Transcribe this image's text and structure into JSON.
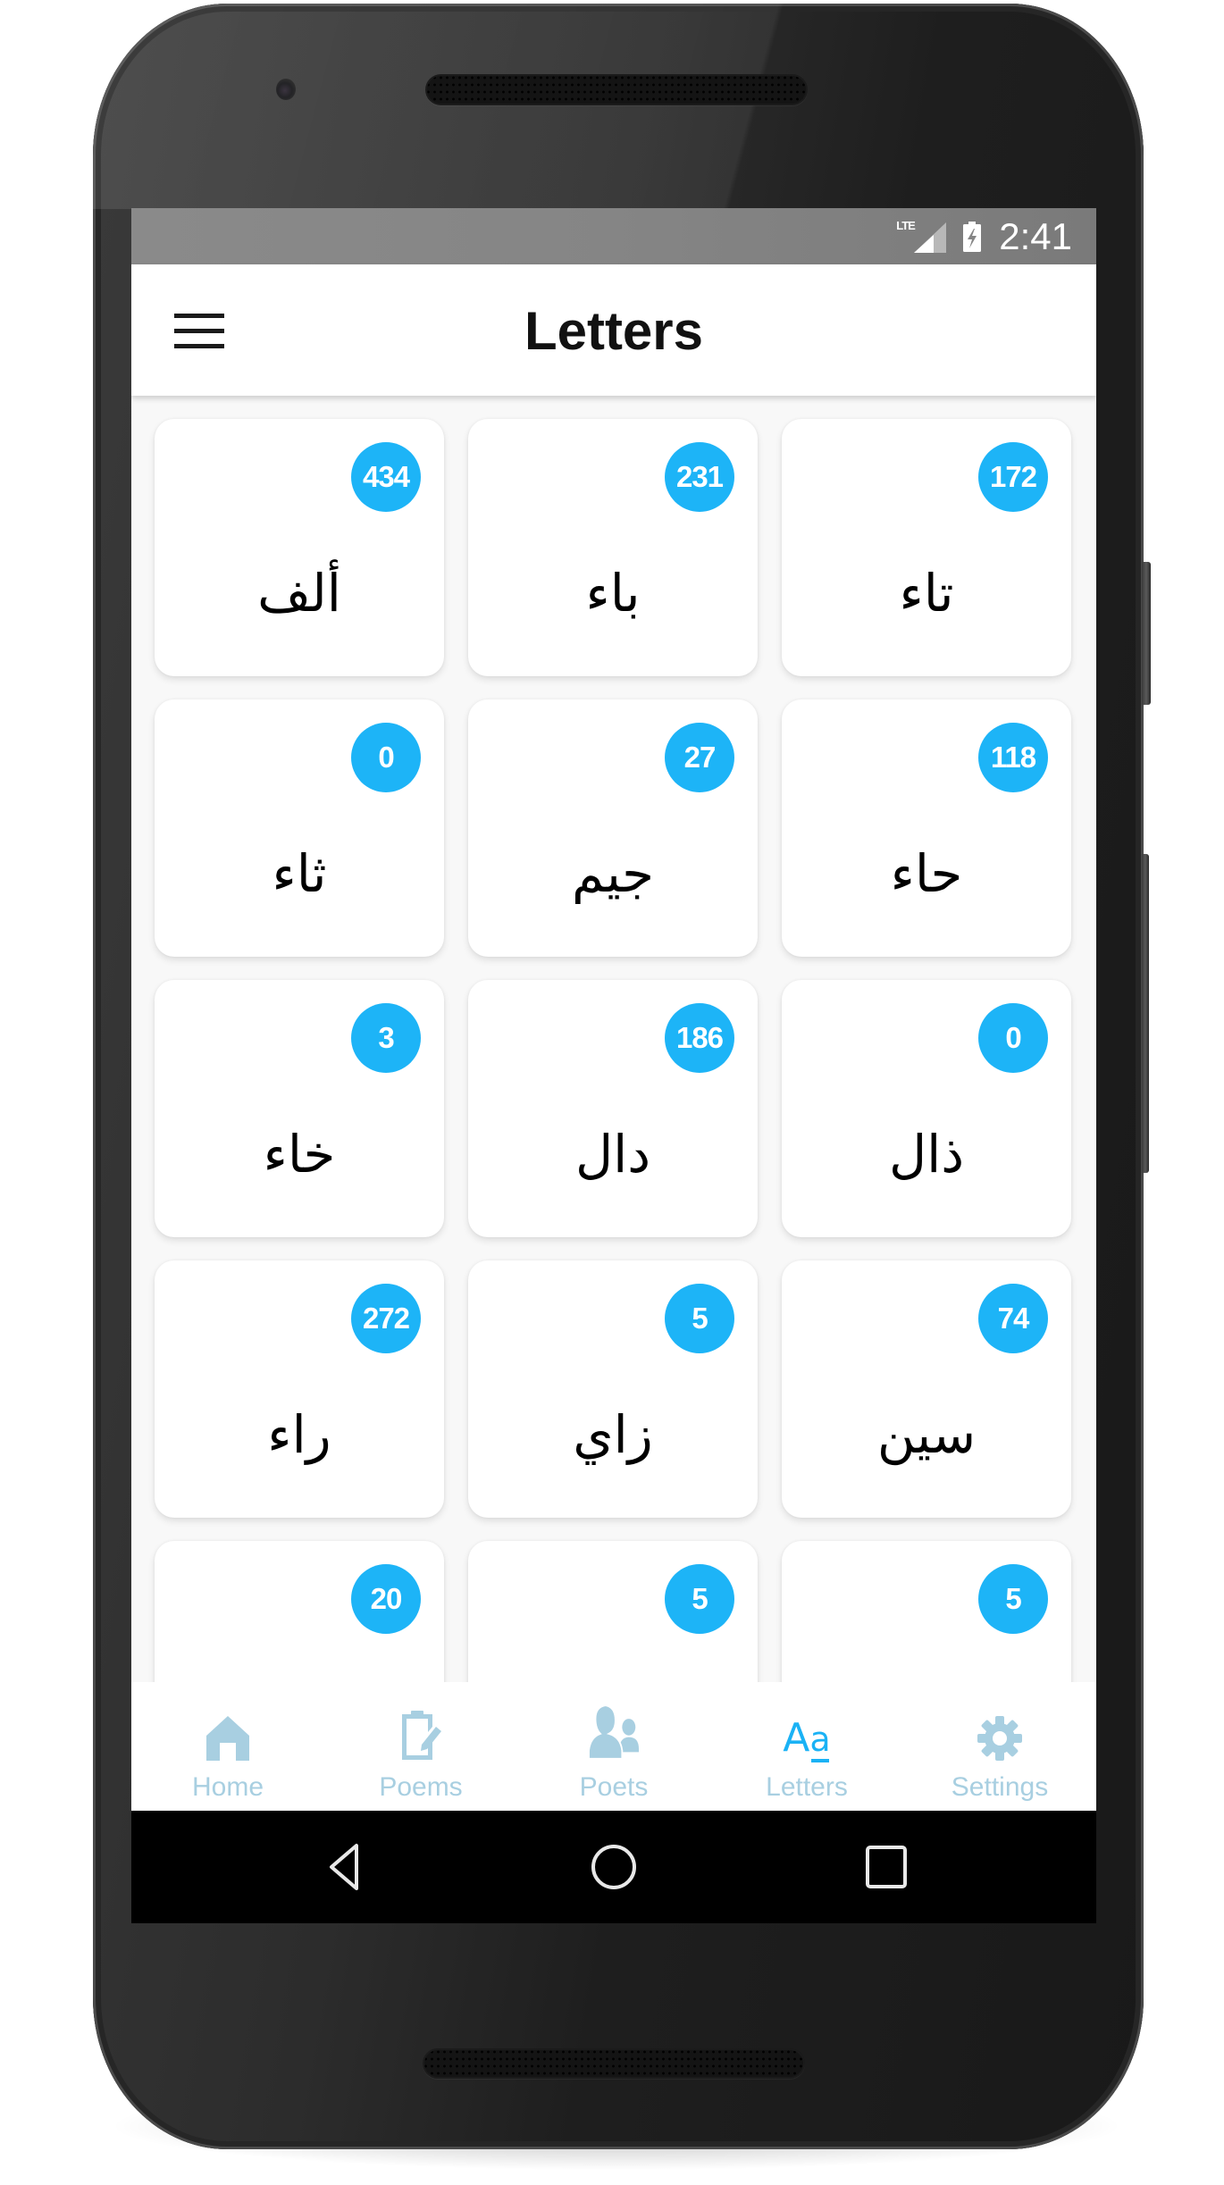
{
  "status_bar": {
    "network_label": "LTE",
    "network_icon": "signal-icon",
    "battery_icon": "battery-charging-icon",
    "time": "2:41"
  },
  "header": {
    "menu_icon": "hamburger-menu-icon",
    "title": "Letters"
  },
  "letters": [
    {
      "name": "ألف",
      "count": "434"
    },
    {
      "name": "باء",
      "count": "231"
    },
    {
      "name": "تاء",
      "count": "172"
    },
    {
      "name": "ثاء",
      "count": "0"
    },
    {
      "name": "جيم",
      "count": "27"
    },
    {
      "name": "حاء",
      "count": "118"
    },
    {
      "name": "خاء",
      "count": "3"
    },
    {
      "name": "دال",
      "count": "186"
    },
    {
      "name": "ذال",
      "count": "0"
    },
    {
      "name": "راء",
      "count": "272"
    },
    {
      "name": "زاي",
      "count": "5"
    },
    {
      "name": "سين",
      "count": "74"
    },
    {
      "name": "",
      "count": "20"
    },
    {
      "name": "",
      "count": "5"
    },
    {
      "name": "",
      "count": "5"
    }
  ],
  "tabs": [
    {
      "label": "Home",
      "icon": "home-icon",
      "active": false
    },
    {
      "label": "Poems",
      "icon": "clipboard-edit-icon",
      "active": false
    },
    {
      "label": "Poets",
      "icon": "users-icon",
      "active": false
    },
    {
      "label": "Letters",
      "icon": "font-size-icon",
      "active": true,
      "icon_glyph_upper": "A",
      "icon_glyph_lower": "a"
    },
    {
      "label": "Settings",
      "icon": "gear-icon",
      "active": false
    }
  ],
  "system_nav": {
    "back_icon": "back-triangle-icon",
    "home_icon": "home-circle-icon",
    "recents_icon": "recents-square-icon"
  },
  "colors": {
    "accent": "#1db4f7",
    "tab_inactive": "#a8cfe1",
    "status_bar": "#858585",
    "background": "#f8f8f8"
  }
}
